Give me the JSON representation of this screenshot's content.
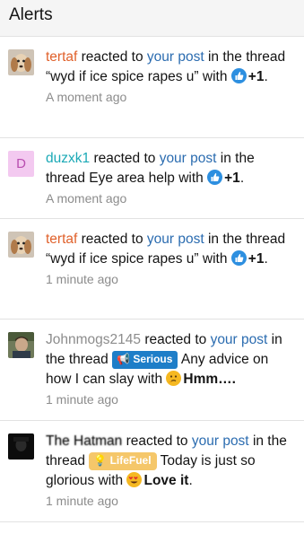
{
  "header": {
    "title": "Alerts"
  },
  "alerts": [
    {
      "user": "tertaf",
      "user_color": "#e0612b",
      "verb": "reacted to",
      "post_link": "your post",
      "mid": "in the thread",
      "thread": "“wyd if ice spice rapes u”",
      "with": "with",
      "reaction": "+1",
      "reaction_icon": "thumbs-up-icon",
      "time": "A moment ago"
    },
    {
      "user": "duzxk1",
      "user_color": "#1aa9b6",
      "avatar_letter": "D",
      "verb": "reacted to",
      "post_link": "your post",
      "mid": "in the thread",
      "thread": "Eye area help",
      "with": "with",
      "reaction": "+1",
      "reaction_icon": "thumbs-up-icon",
      "time": "A moment ago"
    },
    {
      "user": "tertaf",
      "user_color": "#e0612b",
      "verb": "reacted to",
      "post_link": "your post",
      "mid": "in the thread",
      "thread": "“wyd if ice spice rapes u”",
      "with": "with",
      "reaction": "+1",
      "reaction_icon": "thumbs-up-icon",
      "time": "1 minute ago"
    },
    {
      "user": "Johnmogs2145",
      "user_color": "#8c8c8c",
      "verb": "reacted to",
      "post_link": "your post",
      "mid": "in the thread",
      "prefix_label": "Serious",
      "thread": "Any advice on how I can slay",
      "with": "with",
      "reaction": "Hmm….",
      "reaction_icon": "thinking-face-icon",
      "time": "1 minute ago"
    },
    {
      "user": "The Hatman",
      "user_color": "#141414",
      "verb": "reacted to",
      "post_link": "your post",
      "mid": "in the thread",
      "prefix_label": "LifeFuel",
      "thread": "Today is just so glorious",
      "with": "with",
      "reaction": "Love it",
      "reaction_icon": "heart-eyes-icon",
      "time": "1 minute ago"
    }
  ]
}
